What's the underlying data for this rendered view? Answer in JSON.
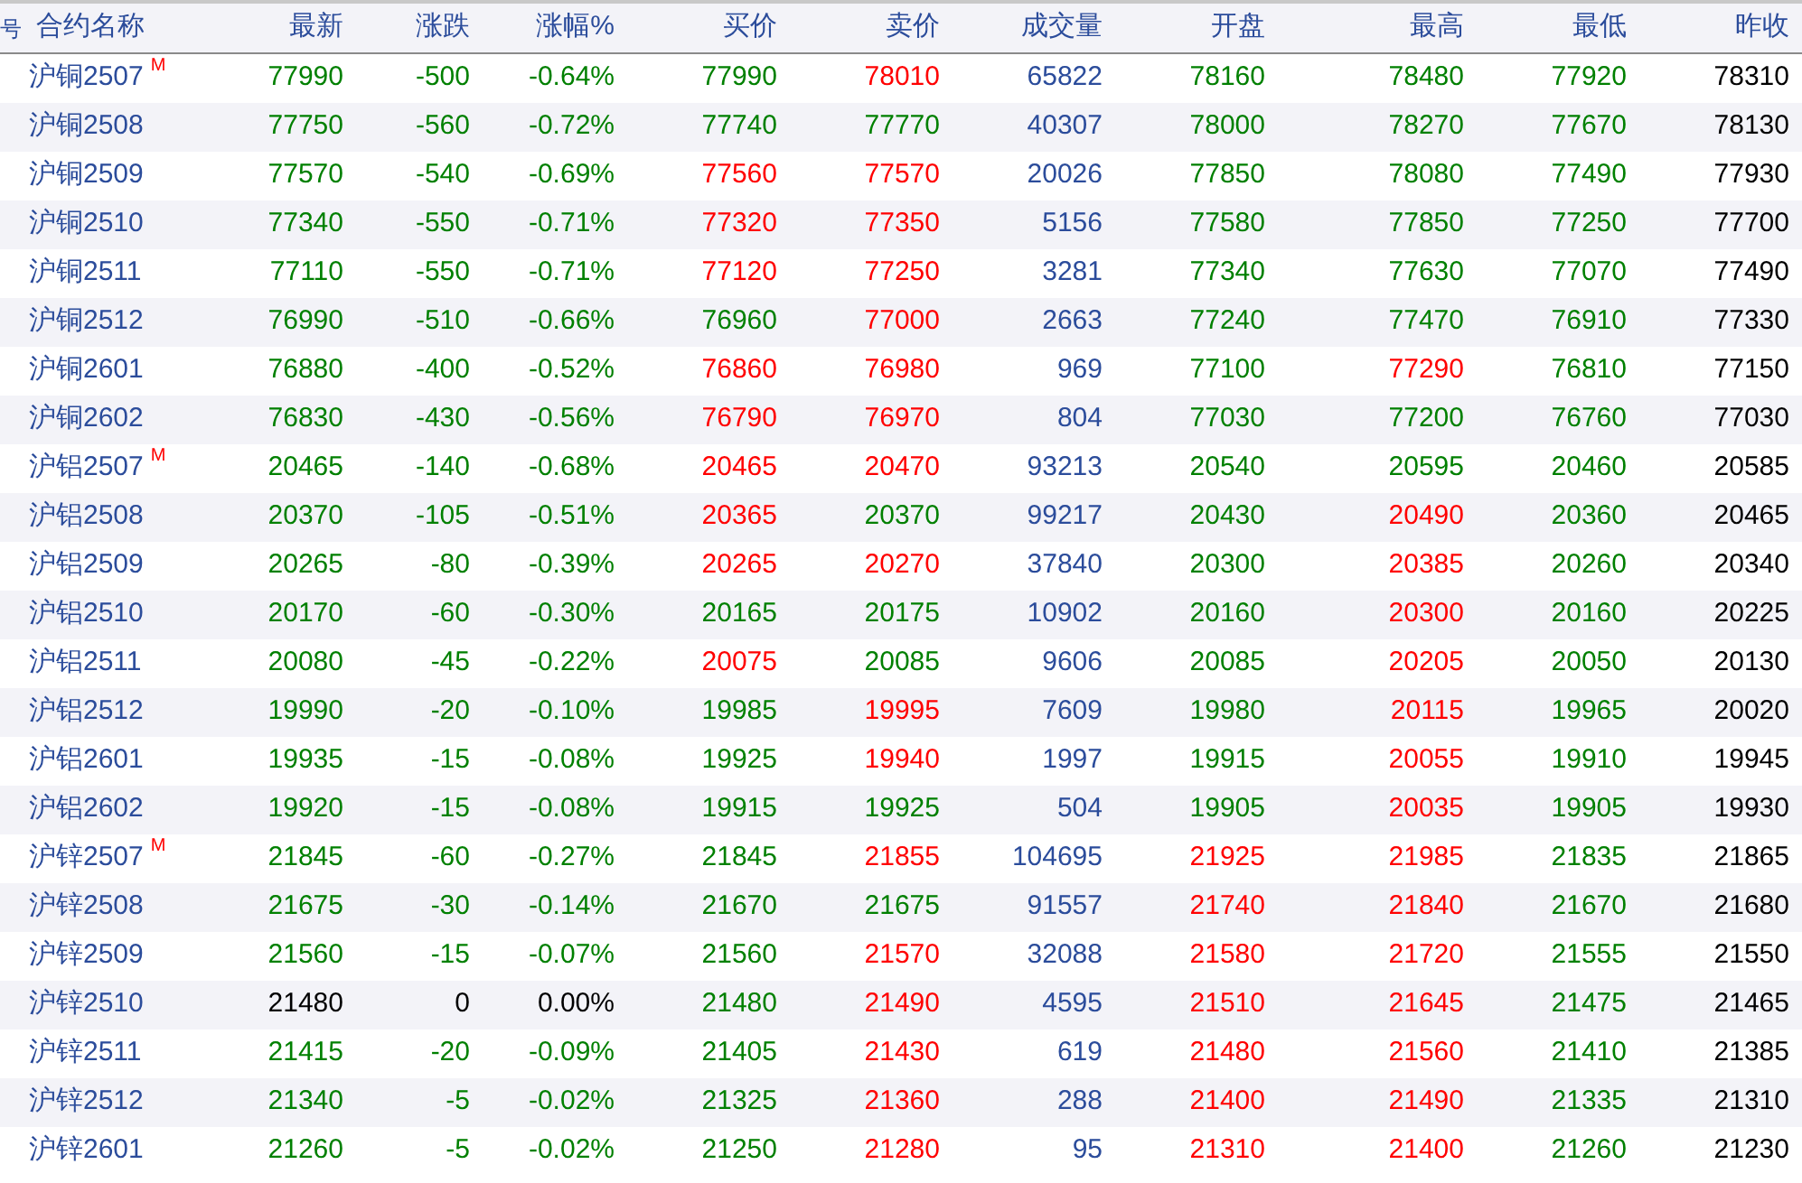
{
  "table": {
    "row_number_header": "号",
    "name_header": "合约名称",
    "columns": [
      "最新",
      "涨跌",
      "涨幅%",
      "买价",
      "卖价",
      "成交量",
      "开盘",
      "最高",
      "最低",
      "昨收"
    ],
    "rows": [
      {
        "name": "沪铜2507",
        "main_mark": "M",
        "cells": [
          {
            "text": "77990",
            "color": "#008000"
          },
          {
            "text": "-500",
            "color": "#008000"
          },
          {
            "text": "-0.64%",
            "color": "#008000"
          },
          {
            "text": "77990",
            "color": "#008000"
          },
          {
            "text": "78010",
            "color": "#ff0000"
          },
          {
            "text": "65822",
            "color": "#2b4c9b"
          },
          {
            "text": "78160",
            "color": "#008000"
          },
          {
            "text": "78480",
            "color": "#008000"
          },
          {
            "text": "77920",
            "color": "#008000"
          },
          {
            "text": "78310",
            "color": "#000000"
          }
        ]
      },
      {
        "name": "沪铜2508",
        "cells": [
          {
            "text": "77750",
            "color": "#008000"
          },
          {
            "text": "-560",
            "color": "#008000"
          },
          {
            "text": "-0.72%",
            "color": "#008000"
          },
          {
            "text": "77740",
            "color": "#008000"
          },
          {
            "text": "77770",
            "color": "#008000"
          },
          {
            "text": "40307",
            "color": "#2b4c9b"
          },
          {
            "text": "78000",
            "color": "#008000"
          },
          {
            "text": "78270",
            "color": "#008000"
          },
          {
            "text": "77670",
            "color": "#008000"
          },
          {
            "text": "78130",
            "color": "#000000"
          }
        ]
      },
      {
        "name": "沪铜2509",
        "cells": [
          {
            "text": "77570",
            "color": "#008000"
          },
          {
            "text": "-540",
            "color": "#008000"
          },
          {
            "text": "-0.69%",
            "color": "#008000"
          },
          {
            "text": "77560",
            "color": "#ff0000"
          },
          {
            "text": "77570",
            "color": "#ff0000"
          },
          {
            "text": "20026",
            "color": "#2b4c9b"
          },
          {
            "text": "77850",
            "color": "#008000"
          },
          {
            "text": "78080",
            "color": "#008000"
          },
          {
            "text": "77490",
            "color": "#008000"
          },
          {
            "text": "77930",
            "color": "#000000"
          }
        ]
      },
      {
        "name": "沪铜2510",
        "cells": [
          {
            "text": "77340",
            "color": "#008000"
          },
          {
            "text": "-550",
            "color": "#008000"
          },
          {
            "text": "-0.71%",
            "color": "#008000"
          },
          {
            "text": "77320",
            "color": "#ff0000"
          },
          {
            "text": "77350",
            "color": "#ff0000"
          },
          {
            "text": "5156",
            "color": "#2b4c9b"
          },
          {
            "text": "77580",
            "color": "#008000"
          },
          {
            "text": "77850",
            "color": "#008000"
          },
          {
            "text": "77250",
            "color": "#008000"
          },
          {
            "text": "77700",
            "color": "#000000"
          }
        ]
      },
      {
        "name": "沪铜2511",
        "cells": [
          {
            "text": "77110",
            "color": "#008000"
          },
          {
            "text": "-550",
            "color": "#008000"
          },
          {
            "text": "-0.71%",
            "color": "#008000"
          },
          {
            "text": "77120",
            "color": "#ff0000"
          },
          {
            "text": "77250",
            "color": "#ff0000"
          },
          {
            "text": "3281",
            "color": "#2b4c9b"
          },
          {
            "text": "77340",
            "color": "#008000"
          },
          {
            "text": "77630",
            "color": "#008000"
          },
          {
            "text": "77070",
            "color": "#008000"
          },
          {
            "text": "77490",
            "color": "#000000"
          }
        ]
      },
      {
        "name": "沪铜2512",
        "cells": [
          {
            "text": "76990",
            "color": "#008000"
          },
          {
            "text": "-510",
            "color": "#008000"
          },
          {
            "text": "-0.66%",
            "color": "#008000"
          },
          {
            "text": "76960",
            "color": "#008000"
          },
          {
            "text": "77000",
            "color": "#ff0000"
          },
          {
            "text": "2663",
            "color": "#2b4c9b"
          },
          {
            "text": "77240",
            "color": "#008000"
          },
          {
            "text": "77470",
            "color": "#008000"
          },
          {
            "text": "76910",
            "color": "#008000"
          },
          {
            "text": "77330",
            "color": "#000000"
          }
        ]
      },
      {
        "name": "沪铜2601",
        "cells": [
          {
            "text": "76880",
            "color": "#008000"
          },
          {
            "text": "-400",
            "color": "#008000"
          },
          {
            "text": "-0.52%",
            "color": "#008000"
          },
          {
            "text": "76860",
            "color": "#ff0000"
          },
          {
            "text": "76980",
            "color": "#ff0000"
          },
          {
            "text": "969",
            "color": "#2b4c9b"
          },
          {
            "text": "77100",
            "color": "#008000"
          },
          {
            "text": "77290",
            "color": "#ff0000"
          },
          {
            "text": "76810",
            "color": "#008000"
          },
          {
            "text": "77150",
            "color": "#000000"
          }
        ]
      },
      {
        "name": "沪铜2602",
        "cells": [
          {
            "text": "76830",
            "color": "#008000"
          },
          {
            "text": "-430",
            "color": "#008000"
          },
          {
            "text": "-0.56%",
            "color": "#008000"
          },
          {
            "text": "76790",
            "color": "#ff0000"
          },
          {
            "text": "76970",
            "color": "#ff0000"
          },
          {
            "text": "804",
            "color": "#2b4c9b"
          },
          {
            "text": "77030",
            "color": "#008000"
          },
          {
            "text": "77200",
            "color": "#008000"
          },
          {
            "text": "76760",
            "color": "#008000"
          },
          {
            "text": "77030",
            "color": "#000000"
          }
        ]
      },
      {
        "name": "沪铝2507",
        "main_mark": "M",
        "cells": [
          {
            "text": "20465",
            "color": "#008000"
          },
          {
            "text": "-140",
            "color": "#008000"
          },
          {
            "text": "-0.68%",
            "color": "#008000"
          },
          {
            "text": "20465",
            "color": "#ff0000"
          },
          {
            "text": "20470",
            "color": "#ff0000"
          },
          {
            "text": "93213",
            "color": "#2b4c9b"
          },
          {
            "text": "20540",
            "color": "#008000"
          },
          {
            "text": "20595",
            "color": "#008000"
          },
          {
            "text": "20460",
            "color": "#008000"
          },
          {
            "text": "20585",
            "color": "#000000"
          }
        ]
      },
      {
        "name": "沪铝2508",
        "cells": [
          {
            "text": "20370",
            "color": "#008000"
          },
          {
            "text": "-105",
            "color": "#008000"
          },
          {
            "text": "-0.51%",
            "color": "#008000"
          },
          {
            "text": "20365",
            "color": "#ff0000"
          },
          {
            "text": "20370",
            "color": "#008000"
          },
          {
            "text": "99217",
            "color": "#2b4c9b"
          },
          {
            "text": "20430",
            "color": "#008000"
          },
          {
            "text": "20490",
            "color": "#ff0000"
          },
          {
            "text": "20360",
            "color": "#008000"
          },
          {
            "text": "20465",
            "color": "#000000"
          }
        ]
      },
      {
        "name": "沪铝2509",
        "cells": [
          {
            "text": "20265",
            "color": "#008000"
          },
          {
            "text": "-80",
            "color": "#008000"
          },
          {
            "text": "-0.39%",
            "color": "#008000"
          },
          {
            "text": "20265",
            "color": "#ff0000"
          },
          {
            "text": "20270",
            "color": "#ff0000"
          },
          {
            "text": "37840",
            "color": "#2b4c9b"
          },
          {
            "text": "20300",
            "color": "#008000"
          },
          {
            "text": "20385",
            "color": "#ff0000"
          },
          {
            "text": "20260",
            "color": "#008000"
          },
          {
            "text": "20340",
            "color": "#000000"
          }
        ]
      },
      {
        "name": "沪铝2510",
        "cells": [
          {
            "text": "20170",
            "color": "#008000"
          },
          {
            "text": "-60",
            "color": "#008000"
          },
          {
            "text": "-0.30%",
            "color": "#008000"
          },
          {
            "text": "20165",
            "color": "#008000"
          },
          {
            "text": "20175",
            "color": "#008000"
          },
          {
            "text": "10902",
            "color": "#2b4c9b"
          },
          {
            "text": "20160",
            "color": "#008000"
          },
          {
            "text": "20300",
            "color": "#ff0000"
          },
          {
            "text": "20160",
            "color": "#008000"
          },
          {
            "text": "20225",
            "color": "#000000"
          }
        ]
      },
      {
        "name": "沪铝2511",
        "cells": [
          {
            "text": "20080",
            "color": "#008000"
          },
          {
            "text": "-45",
            "color": "#008000"
          },
          {
            "text": "-0.22%",
            "color": "#008000"
          },
          {
            "text": "20075",
            "color": "#ff0000"
          },
          {
            "text": "20085",
            "color": "#008000"
          },
          {
            "text": "9606",
            "color": "#2b4c9b"
          },
          {
            "text": "20085",
            "color": "#008000"
          },
          {
            "text": "20205",
            "color": "#ff0000"
          },
          {
            "text": "20050",
            "color": "#008000"
          },
          {
            "text": "20130",
            "color": "#000000"
          }
        ]
      },
      {
        "name": "沪铝2512",
        "cells": [
          {
            "text": "19990",
            "color": "#008000"
          },
          {
            "text": "-20",
            "color": "#008000"
          },
          {
            "text": "-0.10%",
            "color": "#008000"
          },
          {
            "text": "19985",
            "color": "#008000"
          },
          {
            "text": "19995",
            "color": "#ff0000"
          },
          {
            "text": "7609",
            "color": "#2b4c9b"
          },
          {
            "text": "19980",
            "color": "#008000"
          },
          {
            "text": "20115",
            "color": "#ff0000"
          },
          {
            "text": "19965",
            "color": "#008000"
          },
          {
            "text": "20020",
            "color": "#000000"
          }
        ]
      },
      {
        "name": "沪铝2601",
        "cells": [
          {
            "text": "19935",
            "color": "#008000"
          },
          {
            "text": "-15",
            "color": "#008000"
          },
          {
            "text": "-0.08%",
            "color": "#008000"
          },
          {
            "text": "19925",
            "color": "#008000"
          },
          {
            "text": "19940",
            "color": "#ff0000"
          },
          {
            "text": "1997",
            "color": "#2b4c9b"
          },
          {
            "text": "19915",
            "color": "#008000"
          },
          {
            "text": "20055",
            "color": "#ff0000"
          },
          {
            "text": "19910",
            "color": "#008000"
          },
          {
            "text": "19945",
            "color": "#000000"
          }
        ]
      },
      {
        "name": "沪铝2602",
        "cells": [
          {
            "text": "19920",
            "color": "#008000"
          },
          {
            "text": "-15",
            "color": "#008000"
          },
          {
            "text": "-0.08%",
            "color": "#008000"
          },
          {
            "text": "19915",
            "color": "#008000"
          },
          {
            "text": "19925",
            "color": "#008000"
          },
          {
            "text": "504",
            "color": "#2b4c9b"
          },
          {
            "text": "19905",
            "color": "#008000"
          },
          {
            "text": "20035",
            "color": "#ff0000"
          },
          {
            "text": "19905",
            "color": "#008000"
          },
          {
            "text": "19930",
            "color": "#000000"
          }
        ]
      },
      {
        "name": "沪锌2507",
        "main_mark": "M",
        "cells": [
          {
            "text": "21845",
            "color": "#008000"
          },
          {
            "text": "-60",
            "color": "#008000"
          },
          {
            "text": "-0.27%",
            "color": "#008000"
          },
          {
            "text": "21845",
            "color": "#008000"
          },
          {
            "text": "21855",
            "color": "#ff0000"
          },
          {
            "text": "104695",
            "color": "#2b4c9b"
          },
          {
            "text": "21925",
            "color": "#ff0000"
          },
          {
            "text": "21985",
            "color": "#ff0000"
          },
          {
            "text": "21835",
            "color": "#008000"
          },
          {
            "text": "21865",
            "color": "#000000"
          }
        ]
      },
      {
        "name": "沪锌2508",
        "cells": [
          {
            "text": "21675",
            "color": "#008000"
          },
          {
            "text": "-30",
            "color": "#008000"
          },
          {
            "text": "-0.14%",
            "color": "#008000"
          },
          {
            "text": "21670",
            "color": "#008000"
          },
          {
            "text": "21675",
            "color": "#008000"
          },
          {
            "text": "91557",
            "color": "#2b4c9b"
          },
          {
            "text": "21740",
            "color": "#ff0000"
          },
          {
            "text": "21840",
            "color": "#ff0000"
          },
          {
            "text": "21670",
            "color": "#008000"
          },
          {
            "text": "21680",
            "color": "#000000"
          }
        ]
      },
      {
        "name": "沪锌2509",
        "cells": [
          {
            "text": "21560",
            "color": "#008000"
          },
          {
            "text": "-15",
            "color": "#008000"
          },
          {
            "text": "-0.07%",
            "color": "#008000"
          },
          {
            "text": "21560",
            "color": "#008000"
          },
          {
            "text": "21570",
            "color": "#ff0000"
          },
          {
            "text": "32088",
            "color": "#2b4c9b"
          },
          {
            "text": "21580",
            "color": "#ff0000"
          },
          {
            "text": "21720",
            "color": "#ff0000"
          },
          {
            "text": "21555",
            "color": "#008000"
          },
          {
            "text": "21550",
            "color": "#000000"
          }
        ]
      },
      {
        "name": "沪锌2510",
        "cells": [
          {
            "text": "21480",
            "color": "#000000"
          },
          {
            "text": "0",
            "color": "#000000"
          },
          {
            "text": "0.00%",
            "color": "#000000"
          },
          {
            "text": "21480",
            "color": "#008000"
          },
          {
            "text": "21490",
            "color": "#ff0000"
          },
          {
            "text": "4595",
            "color": "#2b4c9b"
          },
          {
            "text": "21510",
            "color": "#ff0000"
          },
          {
            "text": "21645",
            "color": "#ff0000"
          },
          {
            "text": "21475",
            "color": "#008000"
          },
          {
            "text": "21465",
            "color": "#000000"
          }
        ]
      },
      {
        "name": "沪锌2511",
        "cells": [
          {
            "text": "21415",
            "color": "#008000"
          },
          {
            "text": "-20",
            "color": "#008000"
          },
          {
            "text": "-0.09%",
            "color": "#008000"
          },
          {
            "text": "21405",
            "color": "#008000"
          },
          {
            "text": "21430",
            "color": "#ff0000"
          },
          {
            "text": "619",
            "color": "#2b4c9b"
          },
          {
            "text": "21480",
            "color": "#ff0000"
          },
          {
            "text": "21560",
            "color": "#ff0000"
          },
          {
            "text": "21410",
            "color": "#008000"
          },
          {
            "text": "21385",
            "color": "#000000"
          }
        ]
      },
      {
        "name": "沪锌2512",
        "cells": [
          {
            "text": "21340",
            "color": "#008000"
          },
          {
            "text": "-5",
            "color": "#008000"
          },
          {
            "text": "-0.02%",
            "color": "#008000"
          },
          {
            "text": "21325",
            "color": "#008000"
          },
          {
            "text": "21360",
            "color": "#ff0000"
          },
          {
            "text": "288",
            "color": "#2b4c9b"
          },
          {
            "text": "21400",
            "color": "#ff0000"
          },
          {
            "text": "21490",
            "color": "#ff0000"
          },
          {
            "text": "21335",
            "color": "#008000"
          },
          {
            "text": "21310",
            "color": "#000000"
          }
        ]
      },
      {
        "name": "沪锌2601",
        "cells": [
          {
            "text": "21260",
            "color": "#008000"
          },
          {
            "text": "-5",
            "color": "#008000"
          },
          {
            "text": "-0.02%",
            "color": "#008000"
          },
          {
            "text": "21250",
            "color": "#008000"
          },
          {
            "text": "21280",
            "color": "#ff0000"
          },
          {
            "text": "95",
            "color": "#2b4c9b"
          },
          {
            "text": "21310",
            "color": "#ff0000"
          },
          {
            "text": "21400",
            "color": "#ff0000"
          },
          {
            "text": "21260",
            "color": "#008000"
          },
          {
            "text": "21230",
            "color": "#000000"
          }
        ]
      }
    ]
  }
}
